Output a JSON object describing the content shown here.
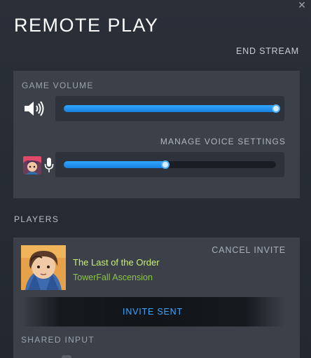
{
  "window": {
    "close_glyph": "✕"
  },
  "header": {
    "title": "REMOTE PLAY",
    "end_stream": "END STREAM"
  },
  "volume": {
    "game_volume_label": "GAME VOLUME",
    "game_volume_level": 1.0,
    "manage_voice_label": "MANAGE VOICE SETTINGS",
    "voice_volume_level": 0.48
  },
  "players": {
    "section_label": "PLAYERS",
    "cancel_invite": "CANCEL INVITE",
    "player_name": "The Last of the Order",
    "player_game": "TowerFall Ascension",
    "invite_status": "INVITE SENT",
    "shared_input_label": "SHARED INPUT"
  },
  "colors": {
    "accent_blue": "#2fa6ff",
    "player_name_green": "#c8f07a",
    "game_green": "#8bc34a",
    "panel_bg": "#3b4049",
    "page_bg": "#262b33"
  },
  "icons": {
    "close": "close-icon",
    "speaker": "speaker-icon",
    "microphone": "microphone-icon"
  }
}
